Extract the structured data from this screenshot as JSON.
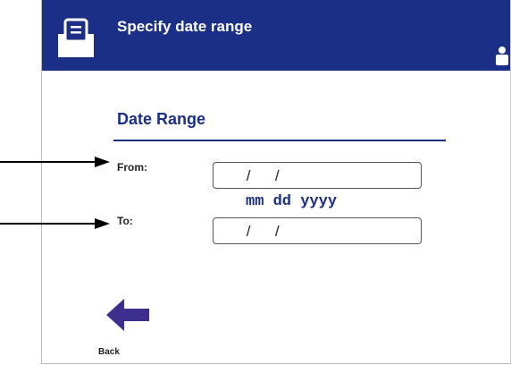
{
  "header": {
    "title": "Specify date range",
    "menu_icon": "document-menu-icon",
    "user_icon": "user-icon",
    "background": "#1b2f86"
  },
  "section": {
    "title": "Date Range"
  },
  "fields": {
    "from": {
      "label": "From:",
      "value": " /  / "
    },
    "to": {
      "label": "To:",
      "value": " /  / "
    }
  },
  "format_hint": "mm dd yyyy",
  "nav": {
    "back_label": "Back",
    "back_icon": "arrow-left-icon"
  }
}
